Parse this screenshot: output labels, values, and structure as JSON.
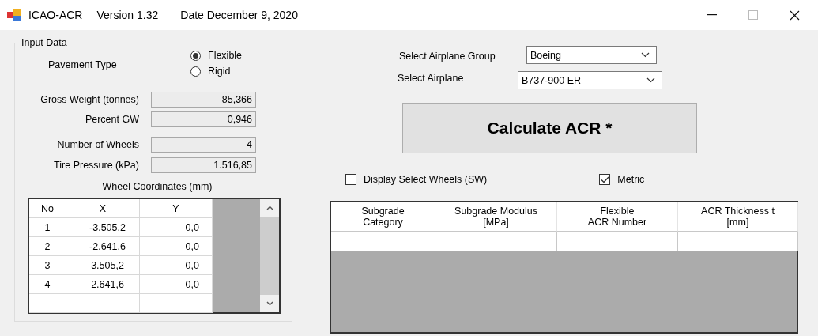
{
  "window": {
    "title": "ICAO-ACR",
    "version": "Version 1.32",
    "date": "Date December 9, 2020"
  },
  "input_data": {
    "title": "Input Data",
    "pavement_type": {
      "label": "Pavement Type",
      "options": [
        {
          "label": "Flexible",
          "selected": true
        },
        {
          "label": "Rigid",
          "selected": false
        }
      ]
    },
    "fields": [
      {
        "label": "Gross Weight (tonnes)",
        "value": "85,366"
      },
      {
        "label": "Percent GW",
        "value": "0,946"
      },
      {
        "label": "Number of Wheels",
        "value": "4"
      },
      {
        "label": "Tire Pressure (kPa)",
        "value": "1.516,85"
      }
    ],
    "wheel_coordinates": {
      "title": "Wheel Coordinates (mm)",
      "columns": [
        "No",
        "X",
        "Y"
      ],
      "rows": [
        [
          "1",
          "-3.505,2",
          "0,0"
        ],
        [
          "2",
          "-2.641,6",
          "0,0"
        ],
        [
          "3",
          "3.505,2",
          "0,0"
        ],
        [
          "4",
          "2.641,6",
          "0,0"
        ]
      ]
    }
  },
  "airplane_group": {
    "label": "Select Airplane Group",
    "value": "Boeing"
  },
  "airplane": {
    "label": "Select Airplane",
    "value": "B737-900 ER"
  },
  "calculate_button": "Calculate ACR *",
  "options": [
    {
      "label": "Display Select Wheels (SW)",
      "checked": false
    },
    {
      "label": "Metric",
      "checked": true
    }
  ],
  "results": {
    "columns": [
      "Subgrade\nCategory",
      "Subgrade Modulus\n[MPa]",
      "Flexible\nACR Number",
      "ACR Thickness t\n[mm]"
    ]
  }
}
